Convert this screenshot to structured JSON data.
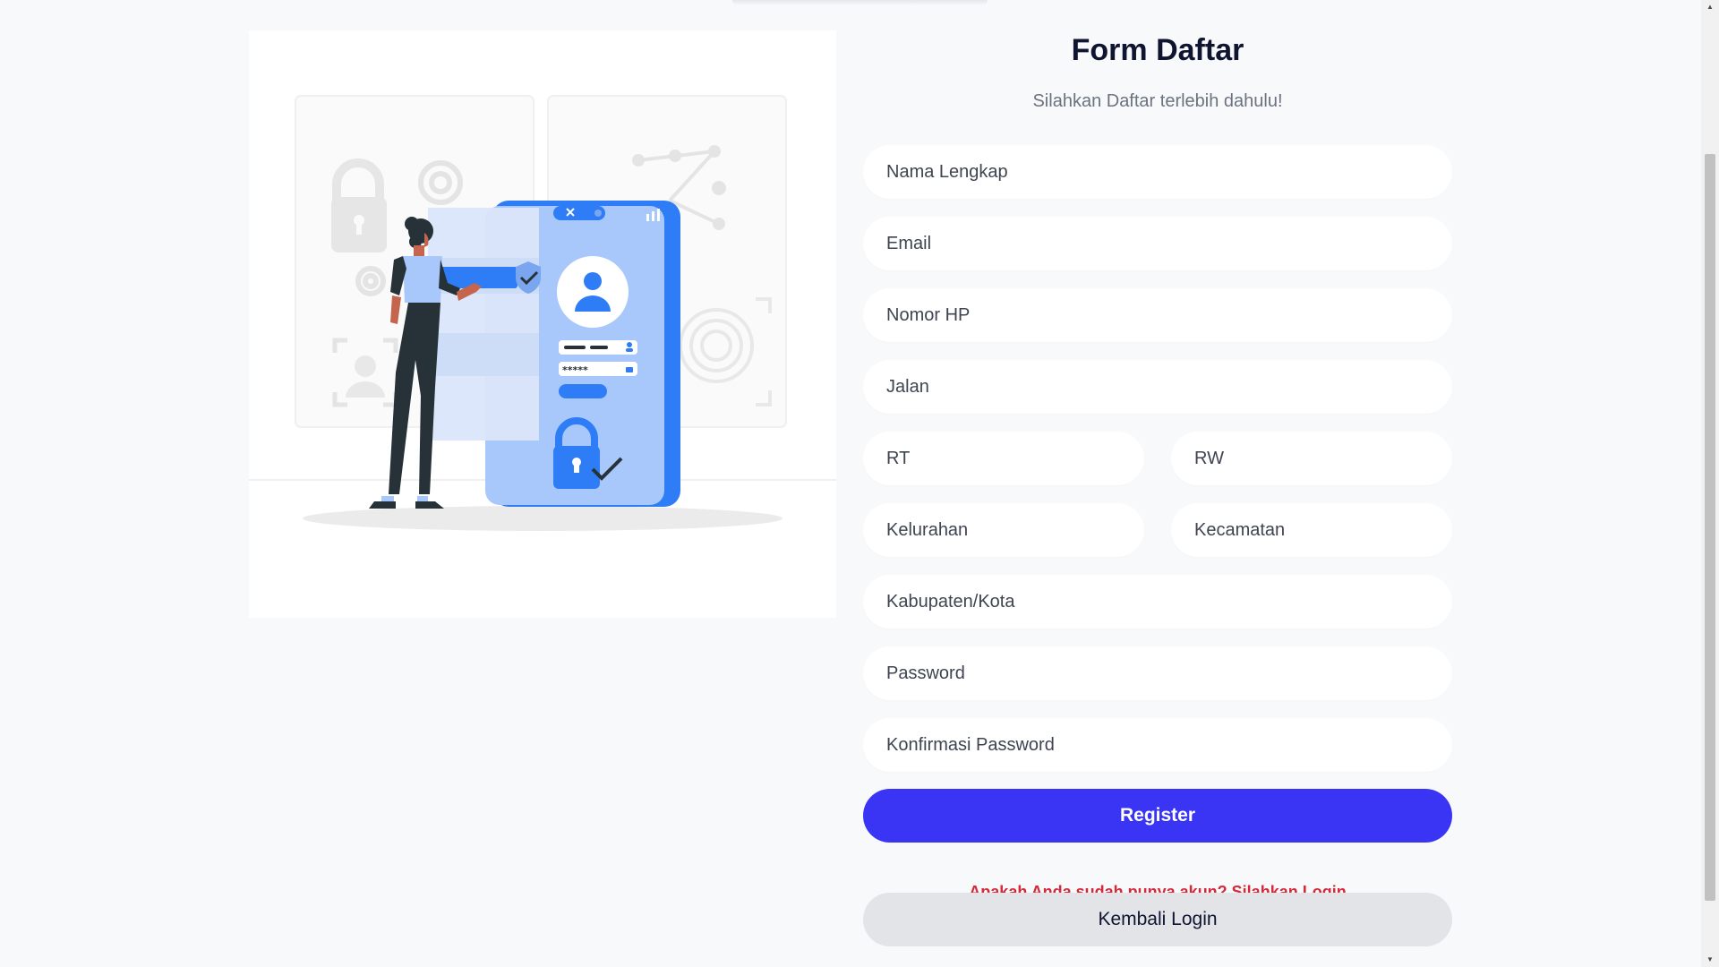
{
  "form": {
    "title": "Form Daftar",
    "subtitle": "Silahkan Daftar terlebih dahulu!",
    "fields": {
      "nama_lengkap": "Nama Lengkap",
      "email": "Email",
      "nomor_hp": "Nomor HP",
      "jalan": "Jalan",
      "rt": "RT",
      "rw": "RW",
      "kelurahan": "Kelurahan",
      "kecamatan": "Kecamatan",
      "kabupaten_kota": "Kabupaten/Kota",
      "password": "Password",
      "konfirmasi_password": "Konfirmasi Password"
    },
    "register_label": "Register",
    "login_prompt": "Apakah Anda sudah punya akun? Silahkan Login",
    "back_label": "Kembali Login"
  },
  "illustration": {
    "password_mask": "*****"
  },
  "scrollbar": {
    "up_arrow": "▲",
    "down_arrow": "▼"
  },
  "colors": {
    "primary": "#3a35f5",
    "link": "#d62839",
    "title": "#0f1530",
    "illustration_blue": "#2f7df6",
    "illustration_light_blue": "#a8c7fa"
  }
}
